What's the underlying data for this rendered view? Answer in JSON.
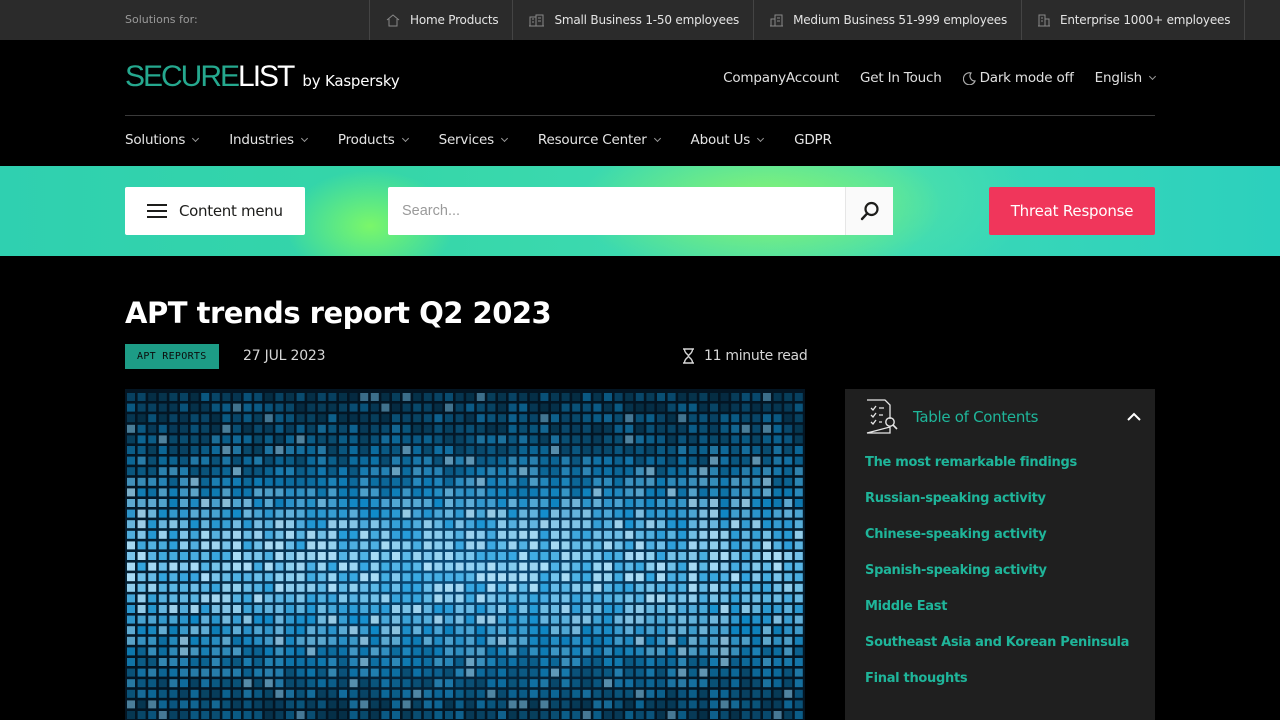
{
  "solutions_bar": {
    "label": "Solutions for:",
    "items": [
      {
        "label": "Home Products",
        "icon": "house-icon"
      },
      {
        "label": "Small Business 1-50 employees",
        "icon": "small-building-icon"
      },
      {
        "label": "Medium Business 51-999 employees",
        "icon": "medium-building-icon"
      },
      {
        "label": "Enterprise 1000+ employees",
        "icon": "enterprise-building-icon"
      }
    ]
  },
  "header": {
    "logo": {
      "part1": "SECURE",
      "part2": "LIST",
      "by": "by Kaspersky"
    },
    "links": {
      "account": "CompanyAccount",
      "contact": "Get In Touch",
      "dark_mode": "Dark mode off",
      "language": "English"
    }
  },
  "nav": {
    "items": [
      {
        "label": "Solutions"
      },
      {
        "label": "Industries"
      },
      {
        "label": "Products"
      },
      {
        "label": "Services"
      },
      {
        "label": "Resource Center"
      },
      {
        "label": "About Us"
      },
      {
        "label": "GDPR"
      }
    ]
  },
  "toolbar": {
    "content_menu": "Content menu",
    "search_placeholder": "Search...",
    "threat_button": "Threat Response"
  },
  "article": {
    "title": "APT trends report Q2 2023",
    "tag": "APT REPORTS",
    "date": "27 JUL 2023",
    "read_time": "11 minute read"
  },
  "toc": {
    "title": "Table of Contents",
    "items": [
      "The most remarkable findings",
      "Russian-speaking activity",
      "Chinese-speaking activity",
      "Spanish-speaking activity",
      "Middle East",
      "Southeast Asia and Korean Peninsula",
      "Final thoughts"
    ]
  },
  "colors": {
    "accent": "#1fb59a",
    "threat": "#f0365b",
    "background": "#000000"
  }
}
